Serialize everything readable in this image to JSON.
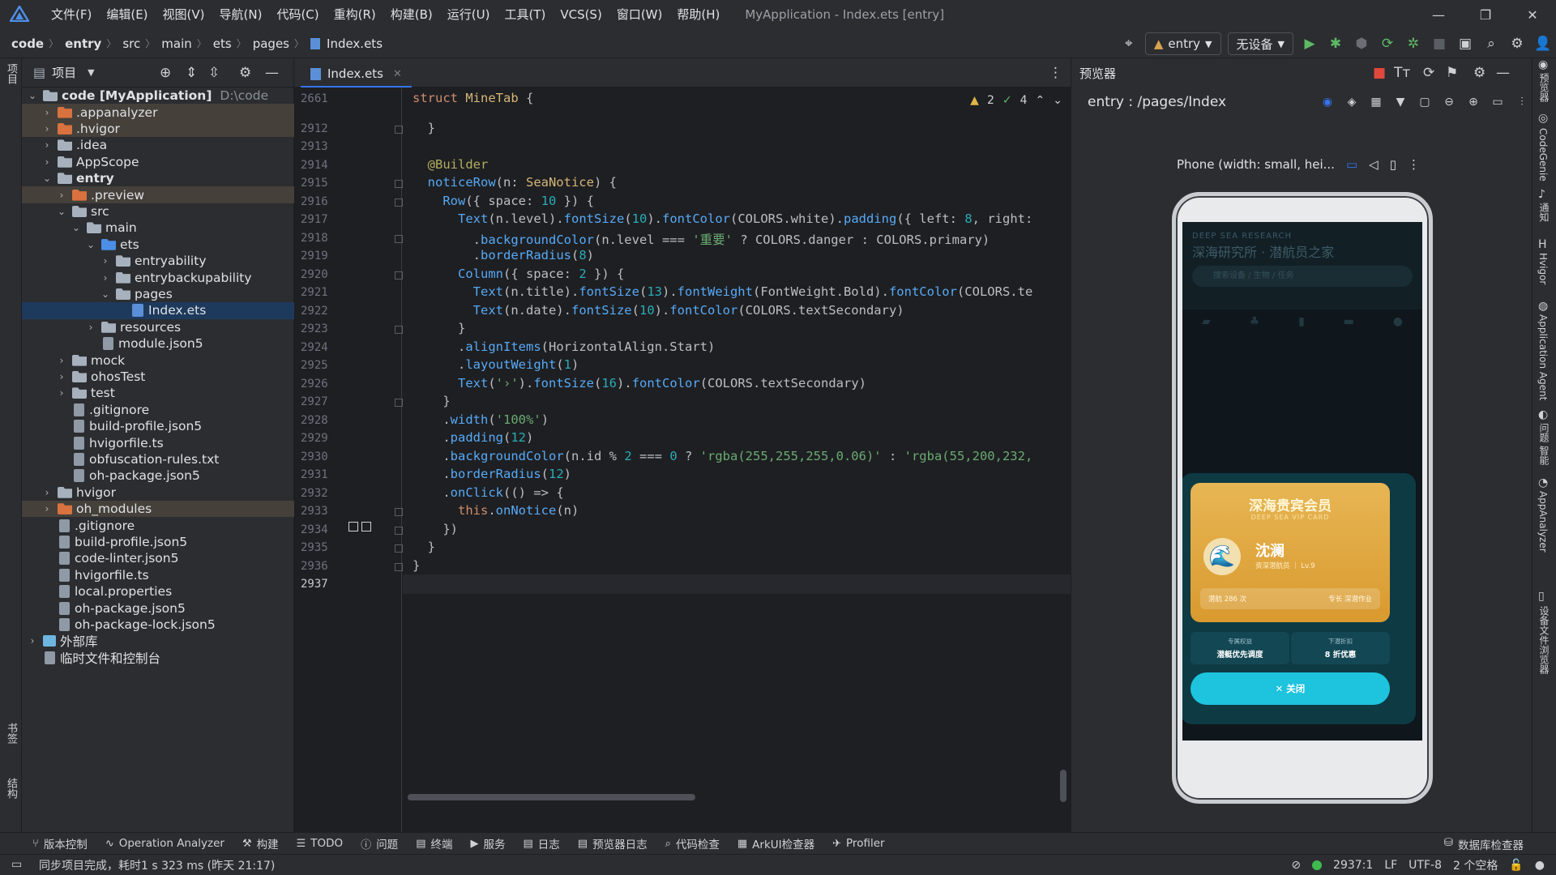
{
  "menubar": {
    "items": [
      "文件(F)",
      "编辑(E)",
      "视图(V)",
      "导航(N)",
      "代码(C)",
      "重构(R)",
      "构建(B)",
      "运行(U)",
      "工具(T)",
      "VCS(S)",
      "窗口(W)",
      "帮助(H)"
    ],
    "title": "MyApplication - Index.ets [entry]",
    "window_controls": [
      "minimize",
      "restore",
      "close"
    ]
  },
  "navbar": {
    "breadcrumb": [
      "code",
      "entry",
      "src",
      "main",
      "ets",
      "pages",
      "Index.ets"
    ],
    "run_config": "entry",
    "device": "无设备"
  },
  "left_strip": {
    "top_tab": "项目",
    "bottom_tabs": [
      "书签",
      "结构"
    ]
  },
  "project_panel": {
    "title": "项目",
    "tree": [
      {
        "label": "code [MyApplication]",
        "suffix": "D:\\code",
        "depth": 0,
        "expanded": true,
        "icon": "folder",
        "style": "root"
      },
      {
        "label": ".appanalyzer",
        "depth": 1,
        "expanded": false,
        "icon": "folder-orange",
        "style": "hl-brown"
      },
      {
        "label": ".hvigor",
        "depth": 1,
        "expanded": false,
        "icon": "folder-orange",
        "style": "hl-brown"
      },
      {
        "label": ".idea",
        "depth": 1,
        "expanded": false,
        "icon": "folder"
      },
      {
        "label": "AppScope",
        "depth": 1,
        "expanded": false,
        "icon": "folder"
      },
      {
        "label": "entry",
        "depth": 1,
        "expanded": true,
        "icon": "folder",
        "style": "bold"
      },
      {
        "label": ".preview",
        "depth": 2,
        "expanded": false,
        "icon": "folder-orange",
        "style": "hl-brown"
      },
      {
        "label": "src",
        "depth": 2,
        "expanded": true,
        "icon": "folder"
      },
      {
        "label": "main",
        "depth": 3,
        "expanded": true,
        "icon": "folder"
      },
      {
        "label": "ets",
        "depth": 4,
        "expanded": true,
        "icon": "folder-blue"
      },
      {
        "label": "entryability",
        "depth": 5,
        "expanded": false,
        "icon": "folder"
      },
      {
        "label": "entrybackupability",
        "depth": 5,
        "expanded": false,
        "icon": "folder"
      },
      {
        "label": "pages",
        "depth": 5,
        "expanded": true,
        "icon": "folder"
      },
      {
        "label": "Index.ets",
        "depth": 6,
        "icon": "ets",
        "style": "selected"
      },
      {
        "label": "resources",
        "depth": 4,
        "expanded": false,
        "icon": "folder"
      },
      {
        "label": "module.json5",
        "depth": 4,
        "icon": "file"
      },
      {
        "label": "mock",
        "depth": 2,
        "expanded": false,
        "icon": "folder"
      },
      {
        "label": "ohosTest",
        "depth": 2,
        "expanded": false,
        "icon": "folder"
      },
      {
        "label": "test",
        "depth": 2,
        "expanded": false,
        "icon": "folder"
      },
      {
        "label": ".gitignore",
        "depth": 2,
        "icon": "file"
      },
      {
        "label": "build-profile.json5",
        "depth": 2,
        "icon": "file"
      },
      {
        "label": "hvigorfile.ts",
        "depth": 2,
        "icon": "file"
      },
      {
        "label": "obfuscation-rules.txt",
        "depth": 2,
        "icon": "file"
      },
      {
        "label": "oh-package.json5",
        "depth": 2,
        "icon": "file"
      },
      {
        "label": "hvigor",
        "depth": 1,
        "expanded": false,
        "icon": "folder"
      },
      {
        "label": "oh_modules",
        "depth": 1,
        "expanded": false,
        "icon": "folder-orange",
        "style": "hl-brown"
      },
      {
        "label": ".gitignore",
        "depth": 1,
        "icon": "file"
      },
      {
        "label": "build-profile.json5",
        "depth": 1,
        "icon": "file"
      },
      {
        "label": "code-linter.json5",
        "depth": 1,
        "icon": "file"
      },
      {
        "label": "hvigorfile.ts",
        "depth": 1,
        "icon": "file"
      },
      {
        "label": "local.properties",
        "depth": 1,
        "icon": "file"
      },
      {
        "label": "oh-package.json5",
        "depth": 1,
        "icon": "file"
      },
      {
        "label": "oh-package-lock.json5",
        "depth": 1,
        "icon": "file"
      },
      {
        "label": "外部库",
        "depth": 0,
        "expanded": false,
        "icon": "lib"
      },
      {
        "label": "临时文件和控制台",
        "depth": 0,
        "icon": "file"
      }
    ]
  },
  "editor": {
    "tab": "Index.ets",
    "inspections": {
      "warnings": "2",
      "checks": "4"
    },
    "current_line": "2937",
    "lines": [
      {
        "n": "2661",
        "code": [
          [
            "k-kw",
            "struct "
          ],
          [
            "k-ty",
            "MineTab"
          ],
          [
            "k-id",
            " {"
          ]
        ]
      },
      {
        "n": "2912",
        "code": [
          [
            "k-id",
            "  }"
          ]
        ]
      },
      {
        "n": "2913",
        "code": []
      },
      {
        "n": "2914",
        "code": [
          [
            "k-dec",
            "  @Builder"
          ]
        ]
      },
      {
        "n": "2915",
        "code": [
          [
            "k-fn",
            "  noticeRow"
          ],
          [
            "k-id",
            "(n: "
          ],
          [
            "k-ty",
            "SeaNotice"
          ],
          [
            "k-id",
            ") {"
          ]
        ]
      },
      {
        "n": "2916",
        "code": [
          [
            "k-fn",
            "    Row"
          ],
          [
            "k-id",
            "({ space: "
          ],
          [
            "k-nm",
            "10"
          ],
          [
            "k-id",
            " }) {"
          ]
        ]
      },
      {
        "n": "2917",
        "code": [
          [
            "k-fn",
            "      Text"
          ],
          [
            "k-id",
            "(n.level)."
          ],
          [
            "k-me",
            "fontSize"
          ],
          [
            "k-id",
            "("
          ],
          [
            "k-nm",
            "10"
          ],
          [
            "k-id",
            ")."
          ],
          [
            "k-me",
            "fontColor"
          ],
          [
            "k-id",
            "(COLORS.white)."
          ],
          [
            "k-me",
            "padding"
          ],
          [
            "k-id",
            "({ left: "
          ],
          [
            "k-nm",
            "8"
          ],
          [
            "k-id",
            ", right:"
          ]
        ]
      },
      {
        "n": "2918",
        "code": [
          [
            "k-id",
            "        ."
          ],
          [
            "k-me",
            "backgroundColor"
          ],
          [
            "k-id",
            "(n.level === "
          ],
          [
            "k-st",
            "'重要'"
          ],
          [
            "k-id",
            " ? COLORS.danger : COLORS.primary)"
          ]
        ]
      },
      {
        "n": "2919",
        "code": [
          [
            "k-id",
            "        ."
          ],
          [
            "k-me",
            "borderRadius"
          ],
          [
            "k-id",
            "("
          ],
          [
            "k-nm",
            "8"
          ],
          [
            "k-id",
            ")"
          ]
        ]
      },
      {
        "n": "2920",
        "code": [
          [
            "k-fn",
            "      Column"
          ],
          [
            "k-id",
            "({ space: "
          ],
          [
            "k-nm",
            "2"
          ],
          [
            "k-id",
            " }) {"
          ]
        ]
      },
      {
        "n": "2921",
        "code": [
          [
            "k-fn",
            "        Text"
          ],
          [
            "k-id",
            "(n.title)."
          ],
          [
            "k-me",
            "fontSize"
          ],
          [
            "k-id",
            "("
          ],
          [
            "k-nm",
            "13"
          ],
          [
            "k-id",
            ")."
          ],
          [
            "k-me",
            "fontWeight"
          ],
          [
            "k-id",
            "(FontWeight.Bold)."
          ],
          [
            "k-me",
            "fontColor"
          ],
          [
            "k-id",
            "(COLORS.te"
          ]
        ]
      },
      {
        "n": "2922",
        "code": [
          [
            "k-fn",
            "        Text"
          ],
          [
            "k-id",
            "(n.date)."
          ],
          [
            "k-me",
            "fontSize"
          ],
          [
            "k-id",
            "("
          ],
          [
            "k-nm",
            "10"
          ],
          [
            "k-id",
            ")."
          ],
          [
            "k-me",
            "fontColor"
          ],
          [
            "k-id",
            "(COLORS.textSecondary)"
          ]
        ]
      },
      {
        "n": "2923",
        "code": [
          [
            "k-id",
            "      }"
          ]
        ]
      },
      {
        "n": "2924",
        "code": [
          [
            "k-id",
            "      ."
          ],
          [
            "k-me",
            "alignItems"
          ],
          [
            "k-id",
            "(HorizontalAlign.Start)"
          ]
        ]
      },
      {
        "n": "2925",
        "code": [
          [
            "k-id",
            "      ."
          ],
          [
            "k-me",
            "layoutWeight"
          ],
          [
            "k-id",
            "("
          ],
          [
            "k-nm",
            "1"
          ],
          [
            "k-id",
            ")"
          ]
        ]
      },
      {
        "n": "2926",
        "code": [
          [
            "k-fn",
            "      Text"
          ],
          [
            "k-id",
            "("
          ],
          [
            "k-st",
            "'›'"
          ],
          [
            "k-id",
            ")."
          ],
          [
            "k-me",
            "fontSize"
          ],
          [
            "k-id",
            "("
          ],
          [
            "k-nm",
            "16"
          ],
          [
            "k-id",
            ")."
          ],
          [
            "k-me",
            "fontColor"
          ],
          [
            "k-id",
            "(COLORS.textSecondary)"
          ]
        ]
      },
      {
        "n": "2927",
        "code": [
          [
            "k-id",
            "    }"
          ]
        ]
      },
      {
        "n": "2928",
        "code": [
          [
            "k-id",
            "    ."
          ],
          [
            "k-me",
            "width"
          ],
          [
            "k-id",
            "("
          ],
          [
            "k-st",
            "'100%'"
          ],
          [
            "k-id",
            ")"
          ]
        ]
      },
      {
        "n": "2929",
        "code": [
          [
            "k-id",
            "    ."
          ],
          [
            "k-me",
            "padding"
          ],
          [
            "k-id",
            "("
          ],
          [
            "k-nm",
            "12"
          ],
          [
            "k-id",
            ")"
          ]
        ]
      },
      {
        "n": "2930",
        "code": [
          [
            "k-id",
            "    ."
          ],
          [
            "k-me",
            "backgroundColor"
          ],
          [
            "k-id",
            "(n.id % "
          ],
          [
            "k-nm",
            "2"
          ],
          [
            "k-id",
            " === "
          ],
          [
            "k-nm",
            "0"
          ],
          [
            "k-id",
            " ? "
          ],
          [
            "k-st",
            "'rgba(255,255,255,0.06)'"
          ],
          [
            "k-id",
            " : "
          ],
          [
            "k-st",
            "'rgba(55,200,232,"
          ]
        ]
      },
      {
        "n": "2931",
        "code": [
          [
            "k-id",
            "    ."
          ],
          [
            "k-me",
            "borderRadius"
          ],
          [
            "k-id",
            "("
          ],
          [
            "k-nm",
            "12"
          ],
          [
            "k-id",
            ")"
          ]
        ]
      },
      {
        "n": "2932",
        "code": [
          [
            "k-id",
            "    ."
          ],
          [
            "k-me",
            "onClick"
          ],
          [
            "k-id",
            "(() => {"
          ]
        ]
      },
      {
        "n": "2933",
        "code": [
          [
            "k-kw",
            "      this"
          ],
          [
            "k-id",
            "."
          ],
          [
            "k-me",
            "onNotice"
          ],
          [
            "k-id",
            "(n)"
          ]
        ]
      },
      {
        "n": "2934",
        "code": [
          [
            "k-id",
            "    })"
          ]
        ]
      },
      {
        "n": "2935",
        "code": [
          [
            "k-id",
            "  }"
          ]
        ]
      },
      {
        "n": "2936",
        "code": [
          [
            "k-id",
            "}"
          ]
        ]
      },
      {
        "n": "2937",
        "code": []
      }
    ]
  },
  "previewer": {
    "title": "预览器",
    "route": "entry : /pages/Index",
    "device_label": "Phone (width: small, hei...",
    "app": {
      "tag": "DEEP SEA RESEARCH",
      "title": "深海研究所 · 潜航员之家",
      "search_placeholder": "搜索设备 / 生物 / 任务",
      "vip_title": "深海贵宾会员",
      "vip_subtitle": "DEEP SEA VIP CARD",
      "name": "沈澜",
      "level": "资深潜航员 ｜ Lv.9",
      "stat_left": "潜航 286 次",
      "stat_right": "专长 深潜作业",
      "benefit1_label": "专属权益",
      "benefit1_value": "潜艇优先调度",
      "benefit2_label": "下潜折扣",
      "benefit2_value": "8 折优惠",
      "close_label": "✕ 关闭"
    }
  },
  "right_strip": [
    "预览器",
    "CodeGenie",
    "通知",
    "Hvigor",
    "Application Agent",
    "问题 智能",
    "AppAnalyzer",
    "设备文件浏览器"
  ],
  "tool_tabs": [
    "版本控制",
    "Operation Analyzer",
    "构建",
    "TODO",
    "问题",
    "终端",
    "服务",
    "日志",
    "预览器日志",
    "代码检查",
    "ArkUI检查器",
    "Profiler"
  ],
  "db_inspector": "数据库检查器",
  "statusbar": {
    "message": "同步项目完成，耗时1 s 323 ms (昨天 21:17)",
    "position": "2937:1",
    "line_sep": "LF",
    "encoding": "UTF-8",
    "indent": "2 个空格"
  },
  "colors": {
    "accent": "#3574f0",
    "selection": "#1d3a5c",
    "highlight": "#45403a",
    "button_cyan": "#1ec3dd",
    "vip_gold": "#e1a843"
  }
}
